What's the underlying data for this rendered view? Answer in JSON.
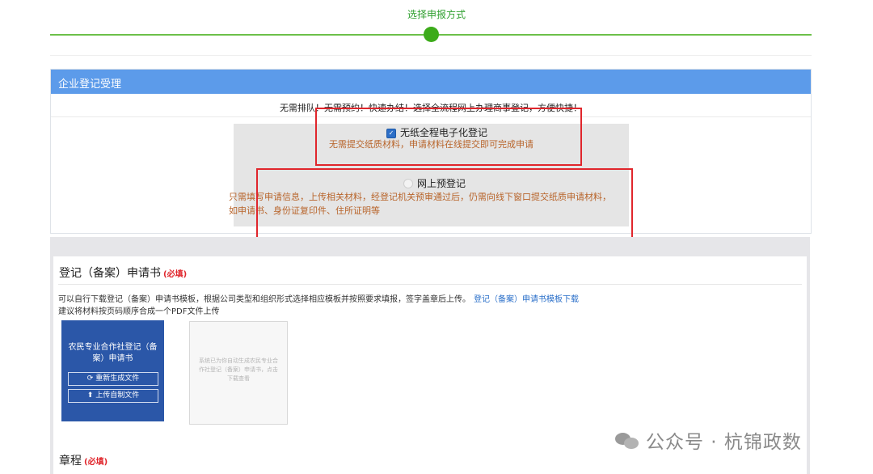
{
  "step": {
    "title": "选择申报方式"
  },
  "panel": {
    "title": "企业登记受理",
    "notice": "无需排队！无需预约！快速办结！选择全流程网上办理商事登记，方便快捷！",
    "option_paperless": {
      "title": "无纸全程电子化登记",
      "desc": "无需提交纸质材料，申请材料在线提交即可完成申请",
      "selected": true
    },
    "option_online_pre": {
      "title": "网上预登记",
      "desc": "只需填写申请信息，上传相关材料，经登记机关预审通过后，仍需向线下窗口提交纸质申请材料，如申请书、身份证复印件、住所证明等",
      "selected": false
    }
  },
  "application_form": {
    "title": "登记（备案）申请书",
    "required_label": "(必填)",
    "description": "可以自行下载登记（备案）申请书模板，根据公司类型和组织形式选择相应模板并按照要求填报，签字盖章后上传。",
    "download_link": "登记（备案）申请书模板下载",
    "note": "建议将材料按页码顺序合成一个PDF文件上传",
    "generated_tile": {
      "title": "农民专业合作社登记（备案）申请书",
      "regenerate_label": "重新生成文件",
      "upload_label": "上传自制文件"
    },
    "preview_tile": {
      "text": "系统已为你自动生成农民专业合作社登记（备案）申请书，点击下载查看"
    }
  },
  "charter": {
    "title": "章程",
    "required_label": "(必填)"
  },
  "watermark": {
    "text": "公众号 · 杭锦政数"
  },
  "colors": {
    "header_blue": "#5c9bea",
    "step_green": "#3cab1a",
    "highlight_red": "#e0262c",
    "tile_blue": "#2b57a8",
    "option_desc": "#b8642a"
  }
}
